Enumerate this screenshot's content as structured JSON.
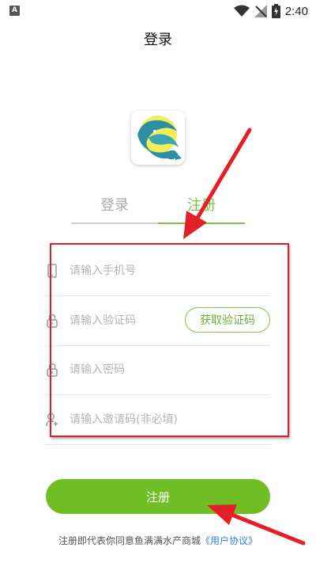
{
  "status_bar": {
    "time": "2:40",
    "badge": "A"
  },
  "page": {
    "title": "登录"
  },
  "tabs": [
    {
      "label": "登录",
      "active": false
    },
    {
      "label": "注册",
      "active": true
    }
  ],
  "form": {
    "phone_placeholder": "请输入手机号",
    "code_placeholder": "请输入验证码",
    "get_code_label": "获取验证码",
    "password_placeholder": "请输入密码",
    "invite_placeholder": "请输入邀请码(非必填)"
  },
  "register_button": {
    "label": "注册"
  },
  "agreement": {
    "text": "注册即代表你同意鱼满满水产商城",
    "link": "《用户协议》"
  },
  "colors": {
    "accent": "#6fbf24",
    "tab_active": "#7bc43f",
    "annotation": "#d8202b",
    "link": "#3b7ddd"
  }
}
